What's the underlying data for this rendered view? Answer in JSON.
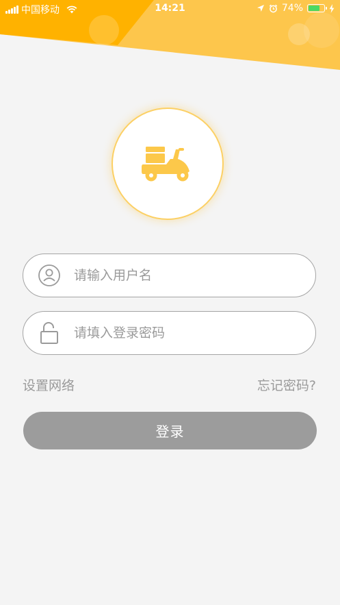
{
  "status_bar": {
    "carrier": "中国移动",
    "time": "14:21",
    "battery_percent": "74%",
    "battery_level": 0.74,
    "icons": [
      "signal-icon",
      "wifi-icon",
      "location-icon",
      "alarm-icon",
      "battery-icon",
      "charging-icon"
    ]
  },
  "logo": {
    "icon": "scooter-icon",
    "color": "#fcc84a"
  },
  "login_form": {
    "username": {
      "icon": "user-icon",
      "placeholder": "请输入用户名",
      "value": ""
    },
    "password": {
      "icon": "unlock-icon",
      "placeholder": "请填入登录密码",
      "value": ""
    },
    "network_settings_label": "设置网络",
    "forgot_password_label": "忘记密码?",
    "login_button_label": "登录"
  },
  "colors": {
    "brand_yellow": "#fcc84a",
    "brand_orange": "#ffb300",
    "background": "#f4f4f4",
    "button_disabled": "#9c9c9c",
    "text_muted": "#9a9a9a"
  }
}
